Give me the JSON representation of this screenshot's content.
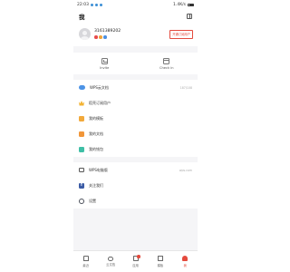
{
  "statusbar": {
    "time": "22:03",
    "network": "1.4K/s"
  },
  "header": {
    "title": "我"
  },
  "profile": {
    "username": "3161389202",
    "vip_button": "开通订阅用户"
  },
  "quick_actions": [
    {
      "label": "Invite",
      "icon": "invite-icon"
    },
    {
      "label": "Check in",
      "icon": "check-in-icon"
    }
  ],
  "menu_group1": [
    {
      "label": "WPS云文档",
      "right": "187/108",
      "icon": "cloud-icon"
    },
    {
      "label": "稻壳订阅用户",
      "right": "",
      "icon": "crown-icon"
    },
    {
      "label": "我的模板",
      "right": "",
      "icon": "template-icon"
    },
    {
      "label": "我的文档",
      "right": "",
      "icon": "document-icon"
    },
    {
      "label": "我的钱包",
      "right": "",
      "icon": "wallet-icon"
    }
  ],
  "menu_group2": [
    {
      "label": "WPS电脑版",
      "right": "wps.com",
      "icon": "monitor-icon"
    },
    {
      "label": "关注我们",
      "right": "",
      "icon": "facebook-icon"
    },
    {
      "label": "设置",
      "right": "",
      "icon": "gear-icon"
    }
  ],
  "tabbar": [
    {
      "label": "最近",
      "icon": "home-icon",
      "active": false
    },
    {
      "label": "云文档",
      "icon": "cloud-icon",
      "active": false
    },
    {
      "label": "应用",
      "icon": "apps-icon",
      "active": false
    },
    {
      "label": "模板",
      "icon": "docs-icon",
      "active": false
    },
    {
      "label": "我",
      "icon": "me-icon",
      "active": true
    }
  ],
  "colors": {
    "accent": "#e44a3d",
    "background": "#f5f5f7"
  }
}
